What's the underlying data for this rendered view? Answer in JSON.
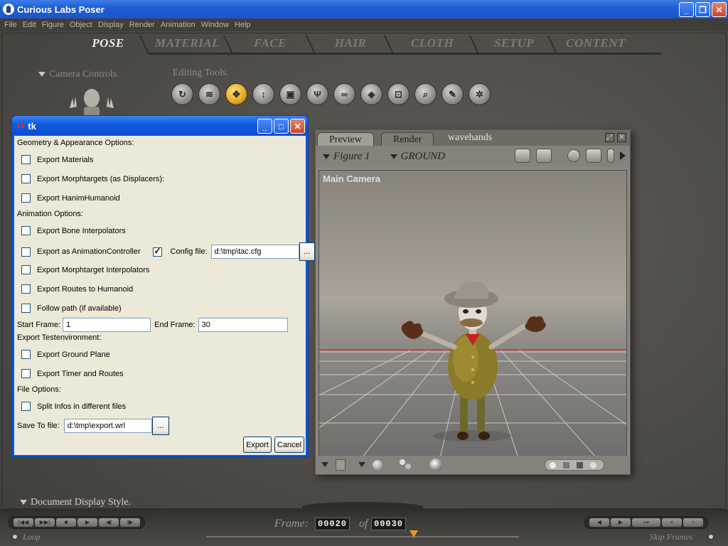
{
  "app": {
    "title": "Curious Labs Poser"
  },
  "menu": [
    "File",
    "Edit",
    "Figure",
    "Object",
    "Display",
    "Render",
    "Animation",
    "Window",
    "Help"
  ],
  "rooms": [
    "POSE",
    "MATERIAL",
    "FACE",
    "HAIR",
    "CLOTH",
    "SETUP",
    "CONTENT"
  ],
  "active_room": "POSE",
  "labels": {
    "camera_controls": "Camera Controls.",
    "editing_tools": "Editing Tools.",
    "document_display_style": "Document Display Style.",
    "loop": "Loop",
    "skip_frames": "Skip Frames"
  },
  "preview": {
    "tabs": [
      "Preview",
      "Render"
    ],
    "document_name": "wavehands",
    "figure_dropdown": "Figure 1",
    "object_dropdown": "GROUND",
    "camera_label": "Main Camera"
  },
  "animation": {
    "frame_label": "Frame:",
    "current_frame": "00020",
    "of_label": "of",
    "total_frames": "00030"
  },
  "dialog": {
    "title": "tk",
    "icon_text": "Tk",
    "geometry_header": "Geometry & Appearance Options:",
    "export_materials": "Export Materials",
    "export_morphtargets": "Export Morphtargets (as Displacers):",
    "export_hanim": "Export HanimHumanoid",
    "animation_header": "Animation Options:",
    "export_bone_interp": "Export Bone Interpolators",
    "export_anim_controller": "Export as AnimationController",
    "config_file_label": "Config file:",
    "config_file_value": "d:\\tmp\\tac.cfg",
    "browse": "...",
    "export_morph_interp": "Export Morphtarget Interpolators",
    "export_routes": "Export Routes to Humanoid",
    "follow_path": "Follow path (if available)",
    "start_frame_label": "Start Frame:",
    "start_frame_value": "1",
    "end_frame_label": "End Frame:",
    "end_frame_value": "30",
    "testenv_header": "Export Testenvironment:",
    "export_ground": "Export Ground Plane",
    "export_timer": "Export Timer and Routes",
    "file_header": "File Options:",
    "split_infos": "Split Infos in different files",
    "save_to_label": "Save To file:",
    "save_to_value": "d:\\tmp\\export.wrl",
    "export_button": "Export",
    "cancel_button": "Cancel"
  }
}
